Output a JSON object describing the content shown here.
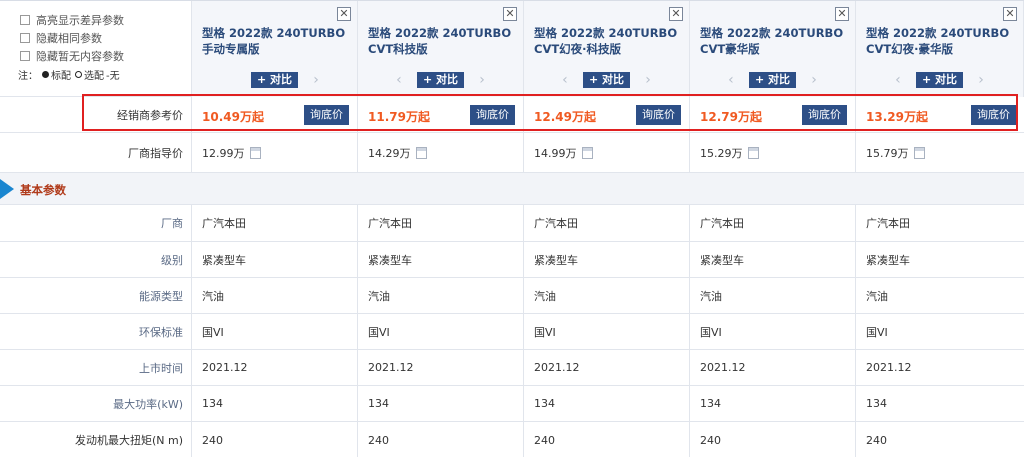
{
  "filters": [
    {
      "label": "高亮显示差异参数"
    },
    {
      "label": "隐藏相同参数"
    },
    {
      "label": "隐藏暂无内容参数"
    }
  ],
  "legend": {
    "prefix": "注：",
    "standard": "标配",
    "optional": "选配",
    "none": "-无"
  },
  "compare_label": "+ 对比",
  "close_symbol": "✕",
  "ask_price_label": "询底价",
  "models": [
    {
      "title": "型格 2022款 240TURBO 手动专属版",
      "dealer_price": "10.49万起",
      "msrp": "12.99万"
    },
    {
      "title": "型格 2022款 240TURBO CVT科技版",
      "dealer_price": "11.79万起",
      "msrp": "14.29万"
    },
    {
      "title": "型格 2022款 240TURBO CVT幻夜·科技版",
      "dealer_price": "12.49万起",
      "msrp": "14.99万"
    },
    {
      "title": "型格 2022款 240TURBO CVT豪华版",
      "dealer_price": "12.79万起",
      "msrp": "15.29万"
    },
    {
      "title": "型格 2022款 240TURBO CVT幻夜·豪华版",
      "dealer_price": "13.29万起",
      "msrp": "15.79万"
    }
  ],
  "dealer_price_label": "经销商参考价",
  "msrp_label": "厂商指导价",
  "section_title": "基本参数",
  "params": [
    {
      "label": "厂商",
      "values": [
        "广汽本田",
        "广汽本田",
        "广汽本田",
        "广汽本田",
        "广汽本田"
      ]
    },
    {
      "label": "级别",
      "values": [
        "紧凑型车",
        "紧凑型车",
        "紧凑型车",
        "紧凑型车",
        "紧凑型车"
      ]
    },
    {
      "label": "能源类型",
      "values": [
        "汽油",
        "汽油",
        "汽油",
        "汽油",
        "汽油"
      ]
    },
    {
      "label": "环保标准",
      "values": [
        "国VI",
        "国VI",
        "国VI",
        "国VI",
        "国VI"
      ]
    },
    {
      "label": "上市时间",
      "values": [
        "2021.12",
        "2021.12",
        "2021.12",
        "2021.12",
        "2021.12"
      ]
    },
    {
      "label": "最大功率(kW)",
      "values": [
        "134",
        "134",
        "134",
        "134",
        "134"
      ]
    },
    {
      "label": "发动机最大扭矩(N m)",
      "values": [
        "240",
        "240",
        "240",
        "240",
        "240"
      ]
    }
  ],
  "colors": {
    "accent": "#2d4f87",
    "price": "#f05a22",
    "highlight": "#e02020",
    "section_marker": "#1a86d0"
  }
}
